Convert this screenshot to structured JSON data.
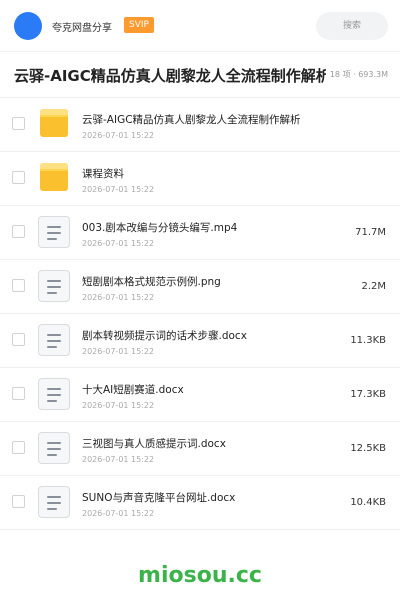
{
  "header": {
    "site_name": "夸克网盘分享",
    "badge": "SVIP",
    "search_placeholder": "搜索"
  },
  "folder": {
    "title": "云驿-AIGC精品仿真人剧黎龙人全流程制作解析",
    "summary": "18 项 · 693.3M"
  },
  "files": [
    {
      "type": "folder",
      "name": "云驿-AIGC精品仿真人剧黎龙人全流程制作解析",
      "date": "2026-07-01 15:22",
      "size": ""
    },
    {
      "type": "folder",
      "name": "课程资料",
      "date": "2026-07-01 15:22",
      "size": ""
    },
    {
      "type": "file",
      "name": "003.剧本改编与分镜头编写.mp4",
      "date": "2026-07-01 15:22",
      "size": "71.7M"
    },
    {
      "type": "file",
      "name": "短剧剧本格式规范示例例.png",
      "date": "2026-07-01 15:22",
      "size": "2.2M"
    },
    {
      "type": "file",
      "name": "剧本转视频提示词的话术步骤.docx",
      "date": "2026-07-01 15:22",
      "size": "11.3KB"
    },
    {
      "type": "file",
      "name": "十大AI短剧赛道.docx",
      "date": "2026-07-01 15:22",
      "size": "17.3KB"
    },
    {
      "type": "file",
      "name": "三视图与真人质感提示词.docx",
      "date": "2026-07-01 15:22",
      "size": "12.5KB"
    },
    {
      "type": "file",
      "name": "SUNO与声音克隆平台网址.docx",
      "date": "2026-07-01 15:22",
      "size": "10.4KB"
    }
  ],
  "watermark": "miosou.cc",
  "colors": {
    "accent": "#2b7bf6",
    "badge": "#ff9a2e",
    "folder": "#fbc02d",
    "watermark": "#3bb34a"
  }
}
